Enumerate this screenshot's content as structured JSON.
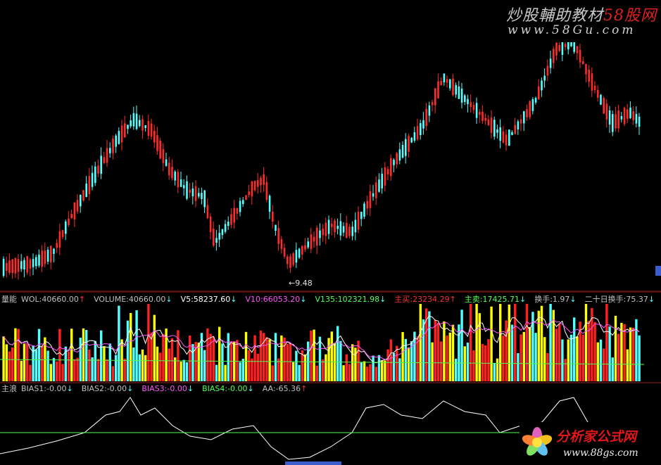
{
  "colors": {
    "up": "#ff2b2b",
    "down": "#54ffff",
    "vol_up": "#ff2020",
    "vol_yellow": "#ffff00",
    "vol_cyan": "#54ffff",
    "line_white": "#ffffff",
    "line_magenta": "#ff54ff",
    "line_green": "#54ff54",
    "separator": "#a02020",
    "label_default": "#c0c0c0"
  },
  "price_panel": {
    "low_marker": "←9.48"
  },
  "volume_panel": {
    "name": "量能",
    "items": [
      {
        "text": "WOL:40660.00",
        "arrow": "↑",
        "color": "#c0c0c0",
        "arrow_color": "#ff3030"
      },
      {
        "text": "VOLUME:40660.00",
        "arrow": "↓",
        "color": "#c0c0c0",
        "arrow_color": "#54ffff"
      },
      {
        "text": "V5:58237.60",
        "arrow": "↓",
        "color": "#ffffff",
        "arrow_color": "#54ffff"
      },
      {
        "text": "V10:66053.20",
        "arrow": "↓",
        "color": "#ff54ff",
        "arrow_color": "#54ffff"
      },
      {
        "text": "V135:102321.98",
        "arrow": "↓",
        "color": "#54ff54",
        "arrow_color": "#54ffff"
      },
      {
        "text": "主买:23234.29",
        "arrow": "↑",
        "color": "#ff3030",
        "arrow_color": "#ff3030"
      },
      {
        "text": "主卖:17425.71",
        "arrow": "↓",
        "color": "#54ff54",
        "arrow_color": "#54ffff"
      },
      {
        "text": "换手:1.97",
        "arrow": "↓",
        "color": "#c0c0c0",
        "arrow_color": "#54ffff"
      },
      {
        "text": "二十日换手:75.37",
        "arrow": "↓",
        "color": "#c0c0c0",
        "arrow_color": "#54ffff"
      }
    ]
  },
  "bias_panel": {
    "name": "主浪",
    "items": [
      {
        "text": "BIAS1:-0.00",
        "arrow": "↓",
        "color": "#c0c0c0",
        "arrow_color": "#54ffff"
      },
      {
        "text": "BIAS2:-0.00",
        "arrow": "↓",
        "color": "#c0c0c0",
        "arrow_color": "#54ffff"
      },
      {
        "text": "BIAS3:-0.00",
        "arrow": "↓",
        "color": "#ff54ff",
        "arrow_color": "#54ffff"
      },
      {
        "text": "BIAS4:-0.00",
        "arrow": "↓",
        "color": "#54ff54",
        "arrow_color": "#54ffff"
      },
      {
        "text": "AA:-65.36",
        "arrow": "↑",
        "color": "#c0c0c0",
        "arrow_color": "#ff3030"
      }
    ]
  },
  "watermark_top": {
    "title_main": "炒股輔助教材",
    "title_red": "58股网",
    "url": "www.58Gu.com"
  },
  "watermark_bottom": {
    "title": "分析家公式网",
    "url": "www.88gs.com"
  },
  "chart_data": {
    "type": "candlestick",
    "low_label": "9.48",
    "volume_labels": [
      "WOL:40660.00",
      "VOLUME:40660.00",
      "V5:58237.60",
      "V10:66053.20",
      "V135:102321.98",
      "主买:23234.29",
      "主卖:17425.71",
      "换手:1.97",
      "二十日换手:75.37"
    ],
    "bias_labels": [
      "BIAS1:-0.00",
      "BIAS2:-0.00",
      "BIAS3:-0.00",
      "BIAS4:-0.00",
      "AA:-65.36"
    ]
  }
}
